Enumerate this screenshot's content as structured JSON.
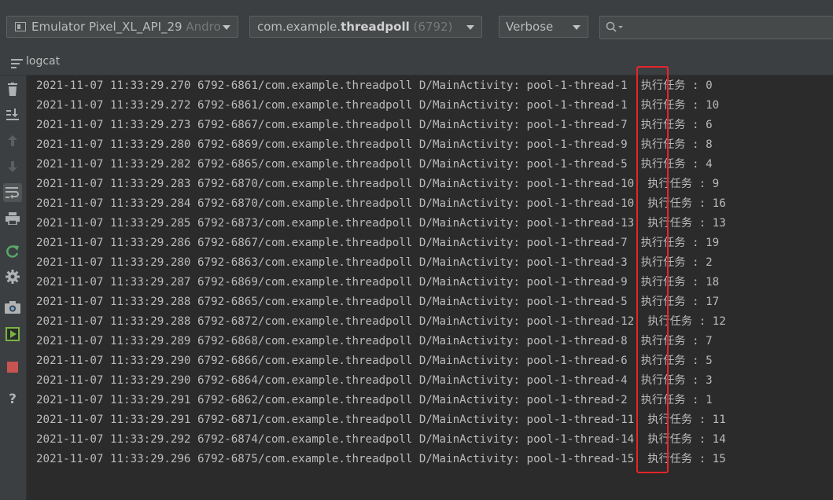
{
  "toolbar": {
    "device_name": "Emulator Pixel_XL_API_29",
    "device_suffix": "Andro",
    "process_package": "com.example.",
    "process_name": "threadpoll",
    "process_pid": "(6792)",
    "log_level": "Verbose",
    "search_value": ""
  },
  "header": {
    "title": "logcat"
  },
  "sidebar": {
    "icons": [
      "trash-icon",
      "scroll-to-end-icon",
      "up-arrow-icon",
      "down-arrow-icon",
      "soft-wrap-icon",
      "print-icon",
      "restart-icon",
      "settings-icon",
      "screen-capture-icon",
      "screen-record-icon",
      "stop-icon",
      "help-icon"
    ]
  },
  "log": {
    "lines": [
      "2021-11-07 11:33:29.270 6792-6861/com.example.threadpoll D/MainActivity: pool-1-thread-1  执行任务 : 0",
      "2021-11-07 11:33:29.272 6792-6861/com.example.threadpoll D/MainActivity: pool-1-thread-1  执行任务 : 10",
      "2021-11-07 11:33:29.273 6792-6867/com.example.threadpoll D/MainActivity: pool-1-thread-7  执行任务 : 6",
      "2021-11-07 11:33:29.280 6792-6869/com.example.threadpoll D/MainActivity: pool-1-thread-9  执行任务 : 8",
      "2021-11-07 11:33:29.282 6792-6865/com.example.threadpoll D/MainActivity: pool-1-thread-5  执行任务 : 4",
      "2021-11-07 11:33:29.283 6792-6870/com.example.threadpoll D/MainActivity: pool-1-thread-10  执行任务 : 9",
      "2021-11-07 11:33:29.284 6792-6870/com.example.threadpoll D/MainActivity: pool-1-thread-10  执行任务 : 16",
      "2021-11-07 11:33:29.285 6792-6873/com.example.threadpoll D/MainActivity: pool-1-thread-13  执行任务 : 13",
      "2021-11-07 11:33:29.286 6792-6867/com.example.threadpoll D/MainActivity: pool-1-thread-7  执行任务 : 19",
      "2021-11-07 11:33:29.280 6792-6863/com.example.threadpoll D/MainActivity: pool-1-thread-3  执行任务 : 2",
      "2021-11-07 11:33:29.287 6792-6869/com.example.threadpoll D/MainActivity: pool-1-thread-9  执行任务 : 18",
      "2021-11-07 11:33:29.288 6792-6865/com.example.threadpoll D/MainActivity: pool-1-thread-5  执行任务 : 17",
      "2021-11-07 11:33:29.288 6792-6872/com.example.threadpoll D/MainActivity: pool-1-thread-12  执行任务 : 12",
      "2021-11-07 11:33:29.289 6792-6868/com.example.threadpoll D/MainActivity: pool-1-thread-8  执行任务 : 7",
      "2021-11-07 11:33:29.290 6792-6866/com.example.threadpoll D/MainActivity: pool-1-thread-6  执行任务 : 5",
      "2021-11-07 11:33:29.290 6792-6864/com.example.threadpoll D/MainActivity: pool-1-thread-4  执行任务 : 3",
      "2021-11-07 11:33:29.291 6792-6862/com.example.threadpoll D/MainActivity: pool-1-thread-2  执行任务 : 1",
      "2021-11-07 11:33:29.291 6792-6871/com.example.threadpoll D/MainActivity: pool-1-thread-11  执行任务 : 11",
      "2021-11-07 11:33:29.292 6792-6874/com.example.threadpoll D/MainActivity: pool-1-thread-14  执行任务 : 14",
      "2021-11-07 11:33:29.296 6792-6875/com.example.threadpoll D/MainActivity: pool-1-thread-15  执行任务 : 15"
    ]
  },
  "colors": {
    "background": "#2b2b2b",
    "toolbar": "#3c3f41",
    "text": "#bbbbbb",
    "highlight": "#e8242a"
  }
}
